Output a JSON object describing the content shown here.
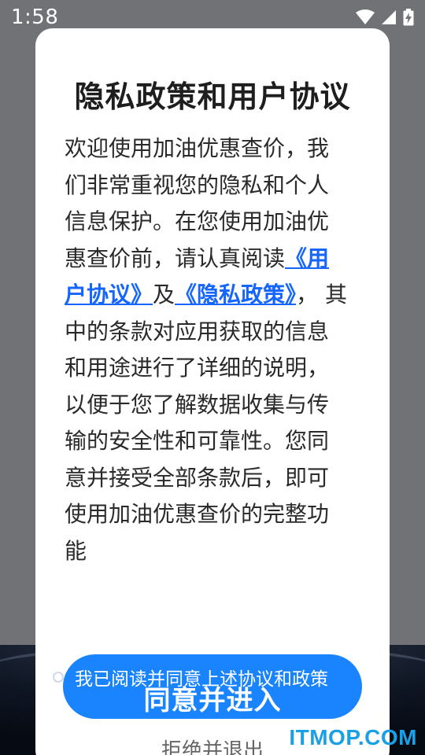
{
  "status_bar": {
    "time": "1:58",
    "icons": [
      "wifi-icon",
      "signal-icon",
      "battery-charging-icon"
    ]
  },
  "dialog": {
    "title": "隐私政策和用户协议",
    "body": {
      "intro": "欢迎使用加油优惠查价，我们非常重视您的隐私和个人信息保护。在您使用加油优惠查价前，请认真阅读",
      "user_agreement_link": "《用户协议》",
      "conjunction": "及",
      "privacy_policy_link": "《隐私政策》",
      "rest": "， 其中的条款对应用获取的信息和用途进行了详细的说明，以便于您了解数据收集与传输的安全性和可靠性。您同意并接受全部条款后，即可使用加油优惠查价的完整功能"
    },
    "consent_checkbox_label": "我已阅读并同意上述协议和政策",
    "agree_button_label": "同意并进入",
    "reject_button_label": "拒绝并退出"
  },
  "watermark": "ITMOP.COM",
  "colors": {
    "link": "#1565ff",
    "primary_button": "#1a84ff",
    "dialog_bg": "#ffffff",
    "backdrop": "#707275"
  }
}
